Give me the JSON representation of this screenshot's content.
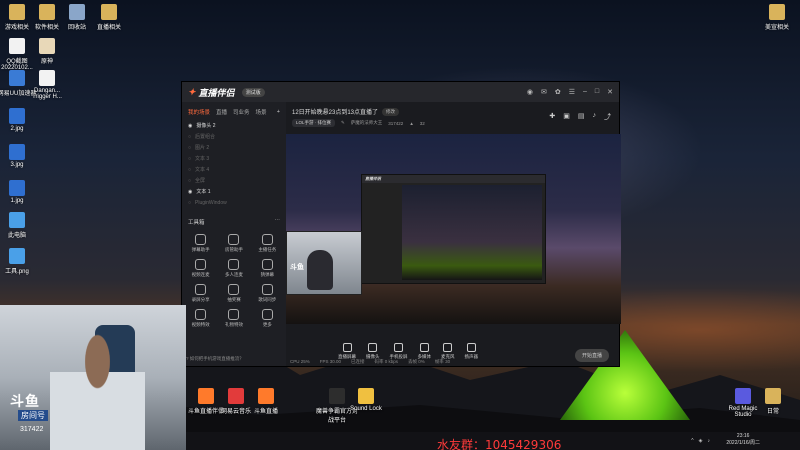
{
  "desktop": {
    "icons_left": [
      {
        "label": "游戏相关",
        "color": "#d9b35b"
      },
      {
        "label": "软件相关",
        "color": "#d9b35b"
      },
      {
        "label": "回收站",
        "color": "#8aa6c9"
      },
      {
        "label": "直播相关",
        "color": "#d9b35b"
      },
      {
        "label": "QQ截图 20220102...",
        "color": "#f2f2f2"
      },
      {
        "label": "原神",
        "color": "#e8d8b8"
      },
      {
        "label": "网易UU加速器",
        "color": "#3a7bd5"
      },
      {
        "label": "Dangan... Trigger H...",
        "color": "#f2f2f2"
      },
      {
        "label": "2.jpg",
        "color": "#2f6fd0"
      },
      {
        "label": "3.jpg",
        "color": "#2f6fd0"
      },
      {
        "label": "1.jpg",
        "color": "#2f6fd0"
      },
      {
        "label": "此电脑",
        "color": "#4aa0e8"
      },
      {
        "label": "工具.png",
        "color": "#4aa0e8"
      }
    ],
    "icons_right": [
      {
        "label": "美宣相关",
        "color": "#d9b35b"
      }
    ],
    "icons_bottom": [
      {
        "label": "斗鱼直播伴侣",
        "color": "#ff7a2b"
      },
      {
        "label": "网易云音乐",
        "color": "#e23b3b"
      },
      {
        "label": "斗鱼直播",
        "color": "#ff7a2b"
      },
      {
        "label": "魔兽争霸官方对战平台",
        "color": "#2d2d2d"
      },
      {
        "label": "Sound Lock",
        "color": "#f0c040"
      },
      {
        "label": "Red Magic Studio",
        "color": "#5a5adf"
      },
      {
        "label": "日常",
        "color": "#d9b35b"
      }
    ]
  },
  "app": {
    "name": "直播伴侣",
    "version_badge": "测试版",
    "titlebar_icons": [
      "avatar-icon",
      "message-icon",
      "skin-icon",
      "menu-icon",
      "minimize-icon",
      "maximize-icon",
      "close-icon"
    ],
    "sidebar": {
      "tabs": [
        "我的场景",
        "直播",
        "司业务",
        "场景"
      ],
      "scenes": [
        {
          "label": "摄像头 2",
          "visible": true
        },
        {
          "label": "后置组合",
          "visible": false
        },
        {
          "label": "图片 2",
          "visible": false
        },
        {
          "label": "文本 3",
          "visible": false
        },
        {
          "label": "文本 4",
          "visible": false
        },
        {
          "label": "全屏",
          "visible": false
        },
        {
          "label": "文本 1",
          "visible": true
        },
        {
          "label": "PluginWindow",
          "visible": false
        }
      ],
      "tools_title": "工具箱",
      "tools": [
        "弹幕助手",
        "房管助手",
        "主播任务",
        "视频连麦",
        "多人连麦",
        "猜弹幕",
        "录屏分享",
        "抽奖赛",
        "歌词同步",
        "视频特效",
        "礼物特效",
        "更多"
      ],
      "hint": "如何把手机游戏直播推流？"
    },
    "room": {
      "title": "12日开始晚悬23点到13点直播了",
      "edit_label": "修改",
      "category": "LOL手游 · 排位赛",
      "owner": "萨魔的法师大王",
      "room_id": "317422",
      "heat": "32"
    },
    "bottom_tools": [
      "直播屏幕",
      "摄像头",
      "手机投屏",
      "多媒体",
      "麦克风",
      "扬声器"
    ],
    "start_button": "开始直播",
    "status": [
      "CPU 25%",
      "FPS 30.00",
      "已连接",
      "码率 0 kbps",
      "丢帧 0%",
      "帧率 30"
    ]
  },
  "webcam": {
    "logo": "斗鱼",
    "room_label": "房间号",
    "room_number": "317422"
  },
  "overlay": {
    "fan_group": "水友群：1045429306"
  },
  "taskbar": {
    "time": "23:16",
    "date": "2022/1/16/周二"
  }
}
